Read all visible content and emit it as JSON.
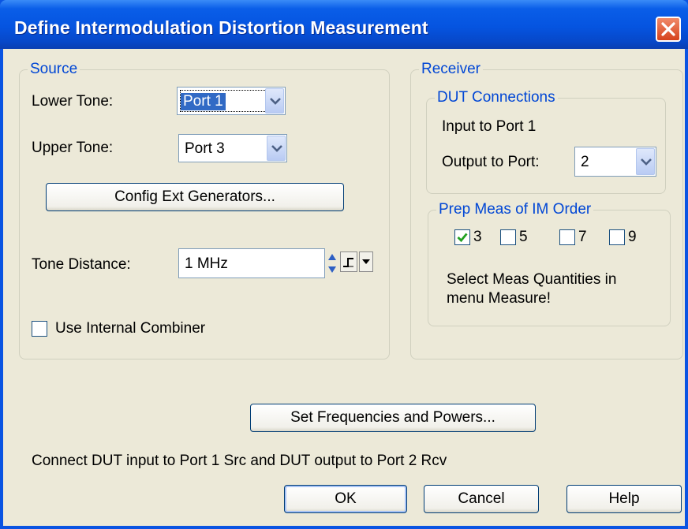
{
  "window": {
    "title": "Define Intermodulation Distortion Measurement"
  },
  "source": {
    "label": "Source",
    "lower_tone_label": "Lower Tone:",
    "lower_tone_value": "Port 1",
    "upper_tone_label": "Upper Tone:",
    "upper_tone_value": "Port 3",
    "config_button": "Config Ext Generators...",
    "tone_distance_label": "Tone Distance:",
    "tone_distance_value": "1 MHz",
    "combiner_label": "Use Internal Combiner",
    "combiner_checked": false
  },
  "receiver": {
    "label": "Receiver",
    "dut": {
      "label": "DUT Connections",
      "input_text": "Input to Port 1",
      "output_label": "Output to Port:",
      "output_value": "2"
    },
    "prep": {
      "label": "Prep Meas of IM Order",
      "orders": [
        {
          "label": "3",
          "checked": true
        },
        {
          "label": "5",
          "checked": false
        },
        {
          "label": "7",
          "checked": false
        },
        {
          "label": "9",
          "checked": false
        }
      ],
      "hint_line1": "Select Meas Quantities in",
      "hint_line2": "menu Measure!"
    }
  },
  "set_freq_button": "Set Frequencies and Powers...",
  "status_text": "Connect DUT input to Port 1 Src and DUT output to Port 2 Rcv",
  "buttons": {
    "ok": "OK",
    "cancel": "Cancel",
    "help": "Help"
  },
  "icons": {
    "close": "close-icon",
    "dropdown": "chevron-down-icon",
    "spin": "spin-arrows-icon",
    "step": "step-icon",
    "check": "checkmark-icon"
  },
  "colors": {
    "title_bar": "#0554e0",
    "group_label": "#0046d5",
    "selection": "#316ac5",
    "close_button": "#d6421c",
    "check": "#21a121"
  }
}
